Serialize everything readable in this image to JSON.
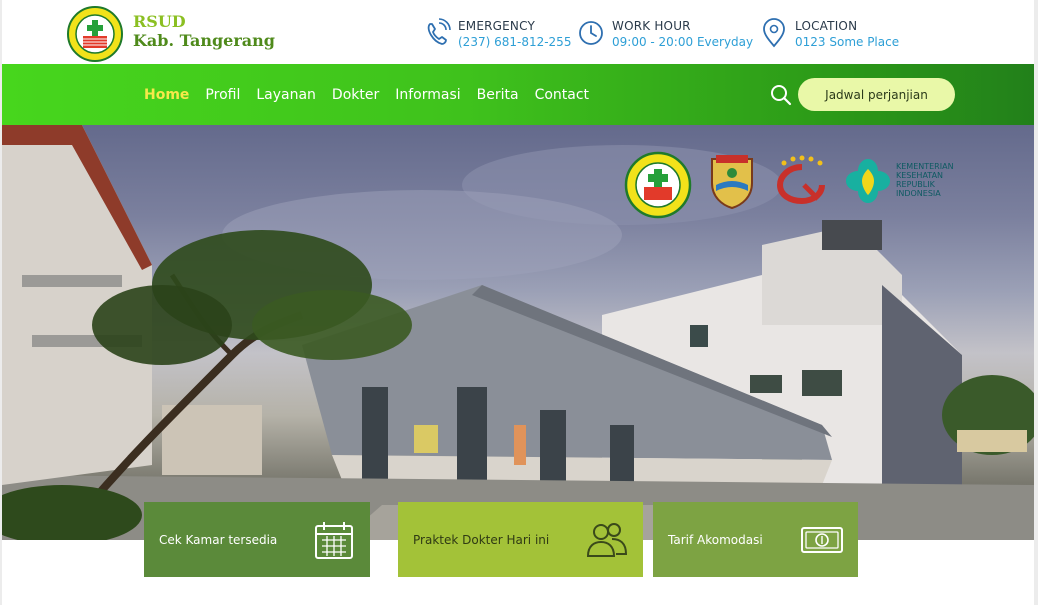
{
  "brand": {
    "line1": "RSUD",
    "line2": "Kab. Tangerang"
  },
  "header_info": [
    {
      "title": "EMERGENCY",
      "value": "(237) 681-812-255",
      "icon": "phone-icon"
    },
    {
      "title": "WORK HOUR",
      "value": "09:00 - 20:00 Everyday",
      "icon": "clock-icon"
    },
    {
      "title": "LOCATION",
      "value": "0123 Some Place",
      "icon": "map-pin-icon"
    }
  ],
  "nav": {
    "items": [
      "Home",
      "Profil",
      "Layanan",
      "Dokter",
      "Informasi",
      "Berita",
      "Contact"
    ],
    "active": "Home",
    "appointment_button": "Jadwal perjanjian"
  },
  "partners": {
    "kemenkes_text": [
      "KEMENTERIAN",
      "KESEHATAN",
      "REPUBLIK",
      "INDONESIA"
    ]
  },
  "cards": [
    {
      "label": "Cek Kamar tersedia",
      "icon": "calendar-icon"
    },
    {
      "label": "Praktek Dokter Hari ini",
      "icon": "people-icon"
    },
    {
      "label": "Tarif Akomodasi",
      "icon": "money-icon"
    }
  ],
  "colors": {
    "nav_green": "#3fc21c",
    "active_menu": "#f5e94a",
    "accent_blue": "#2e9fd6",
    "card1": "#5b8a3a",
    "card2": "#a3c238",
    "card3": "#7da343"
  }
}
